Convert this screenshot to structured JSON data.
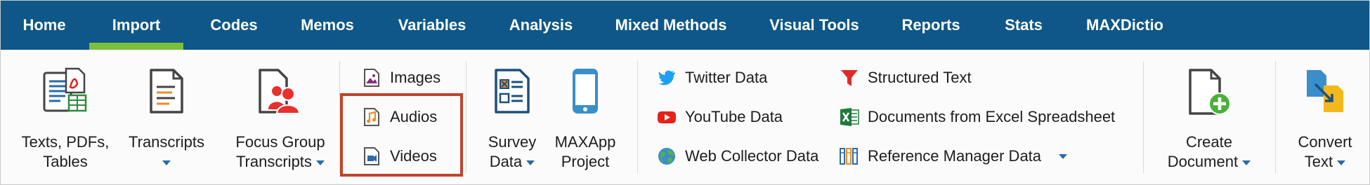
{
  "menu": {
    "tabs": [
      {
        "label": "Home"
      },
      {
        "label": "Import",
        "active": true
      },
      {
        "label": "Codes"
      },
      {
        "label": "Memos"
      },
      {
        "label": "Variables"
      },
      {
        "label": "Analysis"
      },
      {
        "label": "Mixed Methods"
      },
      {
        "label": "Visual Tools"
      },
      {
        "label": "Reports"
      },
      {
        "label": "Stats"
      },
      {
        "label": "MAXDictio"
      }
    ]
  },
  "ribbon": {
    "texts": {
      "line1": "Texts, PDFs,",
      "line2": "Tables",
      "icon": "document-pdf-table-icon"
    },
    "transcripts": {
      "line1": "Transcripts",
      "icon": "transcript-icon"
    },
    "focus_group": {
      "line1": "Focus Group",
      "line2": "Transcripts",
      "icon": "focus-group-icon"
    },
    "media": {
      "images": "Images",
      "audios": "Audios",
      "videos": "Videos"
    },
    "survey": {
      "line1": "Survey",
      "line2": "Data",
      "icon": "survey-form-icon"
    },
    "maxapp": {
      "line1": "MAXApp",
      "line2": "Project",
      "icon": "smartphone-icon"
    },
    "web": {
      "twitter": "Twitter Data",
      "youtube": "YouTube Data",
      "web_collector": "Web Collector Data"
    },
    "structured": {
      "structured_text": "Structured Text",
      "excel": "Documents from Excel Spreadsheet",
      "reference_manager": "Reference Manager Data"
    },
    "create": {
      "line1": "Create",
      "line2": "Document",
      "icon": "new-document-icon"
    },
    "convert": {
      "line1": "Convert",
      "line2": "Text",
      "icon": "convert-text-icon"
    }
  },
  "colors": {
    "menubar": "#0e5788",
    "active_underline": "#7cc03a",
    "highlight_box": "#c0442c",
    "accent_blue": "#2a6aa8"
  }
}
